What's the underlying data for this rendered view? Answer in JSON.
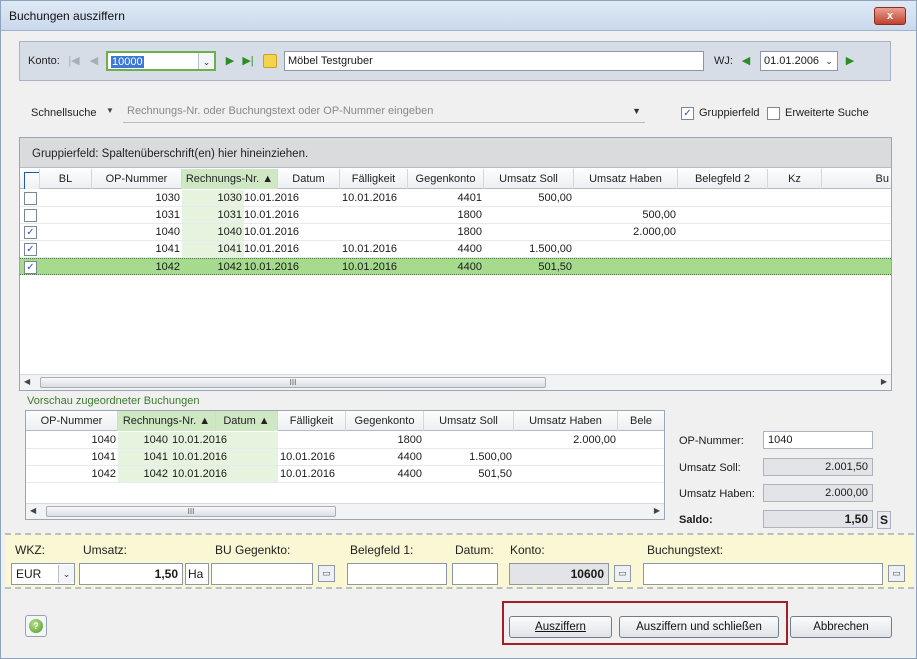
{
  "window": {
    "title": "Buchungen ausziffern",
    "close_label": "x"
  },
  "konto_bar": {
    "konto_label": "Konto:",
    "konto_value": "10000",
    "konto_name": "Möbel Testgruber",
    "wj_label": "WJ:",
    "wj_value": "01.01.2006"
  },
  "search": {
    "label": "Schnellsuche",
    "placeholder": "Rechnungs-Nr. oder Buchungstext oder OP-Nummer eingeben",
    "gruppierfeld_label": "Gruppierfeld",
    "gruppierfeld_checked": true,
    "erweiterte_label": "Erweiterte Suche",
    "erweiterte_checked": false
  },
  "grid": {
    "group_hint": "Gruppierfeld: Spaltenüberschrift(en) hier hineinziehen.",
    "columns": [
      "",
      "BL",
      "OP-Nummer",
      "Rechnungs-Nr. ▲",
      "Datum",
      "Fälligkeit",
      "Gegenkonto",
      "Umsatz Soll",
      "Umsatz Haben",
      "Belegfeld 2",
      "Kz",
      "Bu"
    ],
    "rows": [
      {
        "checked": false,
        "bl": "",
        "op": "1030",
        "rn": "1030",
        "datum": "10.01.2016",
        "faellig": "10.01.2016",
        "gegenkonto": "4401",
        "soll": "500,00",
        "haben": "",
        "selected": false
      },
      {
        "checked": false,
        "bl": "",
        "op": "1031",
        "rn": "1031",
        "datum": "10.01.2016",
        "faellig": "",
        "gegenkonto": "1800",
        "soll": "",
        "haben": "500,00",
        "selected": false
      },
      {
        "checked": true,
        "bl": "",
        "op": "1040",
        "rn": "1040",
        "datum": "10.01.2016",
        "faellig": "",
        "gegenkonto": "1800",
        "soll": "",
        "haben": "2.000,00",
        "selected": false
      },
      {
        "checked": true,
        "bl": "",
        "op": "1041",
        "rn": "1041",
        "datum": "10.01.2016",
        "faellig": "10.01.2016",
        "gegenkonto": "4400",
        "soll": "1.500,00",
        "haben": "",
        "selected": false
      },
      {
        "checked": true,
        "bl": "",
        "op": "1042",
        "rn": "1042",
        "datum": "10.01.2016",
        "faellig": "10.01.2016",
        "gegenkonto": "4400",
        "soll": "501,50",
        "haben": "",
        "selected": true
      }
    ],
    "scroll_thumb": "III"
  },
  "preview": {
    "legend": "Vorschau zugeordneter Buchungen",
    "columns": [
      "OP-Nummer",
      "Rechnungs-Nr. ▲",
      "Datum ▲",
      "Fälligkeit",
      "Gegenkonto",
      "Umsatz Soll",
      "Umsatz Haben",
      "Bele"
    ],
    "rows": [
      {
        "op": "1040",
        "rn": "1040",
        "datum": "10.01.2016",
        "faellig": "",
        "gegenkonto": "1800",
        "soll": "",
        "haben": "2.000,00"
      },
      {
        "op": "1041",
        "rn": "1041",
        "datum": "10.01.2016",
        "faellig": "10.01.2016",
        "gegenkonto": "4400",
        "soll": "1.500,00",
        "haben": ""
      },
      {
        "op": "1042",
        "rn": "1042",
        "datum": "10.01.2016",
        "faellig": "10.01.2016",
        "gegenkonto": "4400",
        "soll": "501,50",
        "haben": ""
      }
    ],
    "scroll_thumb": "III"
  },
  "summary": {
    "op_label": "OP-Nummer:",
    "op_value": "1040",
    "soll_label": "Umsatz Soll:",
    "soll_value": "2.001,50",
    "haben_label": "Umsatz Haben:",
    "haben_value": "2.000,00",
    "saldo_label": "Saldo:",
    "saldo_value": "1,50",
    "saldo_side": "S"
  },
  "entry": {
    "wkz_label": "WKZ:",
    "wkz_value": "EUR",
    "umsatz_label": "Umsatz:",
    "umsatz_value": "1,50",
    "ha_value": "Ha",
    "bu_label": "BU Gegenkto:",
    "beleg_label": "Belegfeld 1:",
    "datum_label": "Datum:",
    "konto_label": "Konto:",
    "konto_value": "10600",
    "text_label": "Buchungstext:"
  },
  "buttons": {
    "ausziffern": "Ausziffern",
    "ausziffern_schliessen": "Ausziffern und schließen",
    "abbrechen": "Abbrechen"
  },
  "colors": {
    "selected_row": "#a6da8c",
    "sorted_col": "#cfe8c4",
    "highlight_box": "#a21f2a",
    "entry_band": "#f9f7d4"
  }
}
